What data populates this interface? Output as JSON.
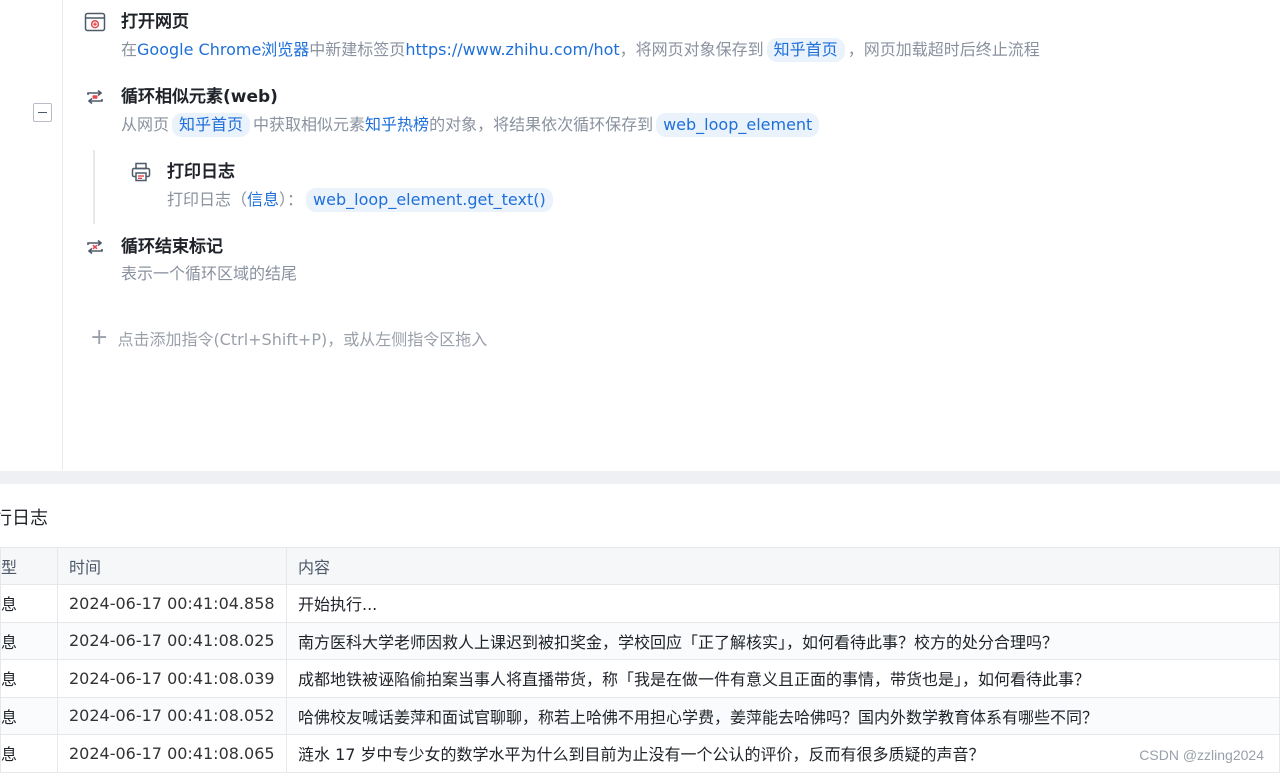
{
  "flow": {
    "steps": [
      {
        "title": "打开网页",
        "desc": {
          "t1": "在",
          "browser": "Google Chrome浏览器",
          "t2": "中新建标签页",
          "url": "https://www.zhihu.com/hot",
          "t3": "，将网页对象保存到",
          "var": "知乎首页",
          "t4": "，网页加载超时后终止流程"
        }
      },
      {
        "title": "循环相似元素(web)",
        "desc": {
          "t1": "从网页",
          "page": "知乎首页",
          "t2": "中获取相似元素",
          "elem": "知乎热榜",
          "t3": "的对象，将结果依次循环保存到",
          "var": "web_loop_element"
        }
      },
      {
        "title": "打印日志",
        "desc": {
          "t1": "打印日志（",
          "level": "信息",
          "t2": "）：",
          "expr": "web_loop_element.get_text()"
        }
      },
      {
        "title": "循环结束标记",
        "desc": {
          "t1": "表示一个循环区域的结尾"
        }
      }
    ],
    "add_hint": "点击添加指令(Ctrl+Shift+P)，或从左侧指令区拖入"
  },
  "log": {
    "title": "行日志",
    "columns": [
      "型",
      "时间",
      "内容"
    ],
    "rows": [
      {
        "type": "息",
        "time": "2024-06-17 00:41:04.858",
        "content": "开始执行..."
      },
      {
        "type": "息",
        "time": "2024-06-17 00:41:08.025",
        "content": "南方医科大学老师因救人上课迟到被扣奖金，学校回应「正了解核实」，如何看待此事？校方的处分合理吗？"
      },
      {
        "type": "息",
        "time": "2024-06-17 00:41:08.039",
        "content": "成都地铁被诬陷偷拍案当事人将直播带货，称「我是在做一件有意义且正面的事情，带货也是」，如何看待此事？"
      },
      {
        "type": "息",
        "time": "2024-06-17 00:41:08.052",
        "content": "哈佛校友喊话姜萍和面试官聊聊，称若上哈佛不用担心学费，姜萍能去哈佛吗？国内外数学教育体系有哪些不同？"
      },
      {
        "type": "息",
        "time": "2024-06-17 00:41:08.065",
        "content": "涟水 17 岁中专少女的数学水平为什么到目前为止没有一个公认的评价，反而有很多质疑的声音？"
      }
    ]
  },
  "watermark": "CSDN @zzling2024",
  "colors": {
    "link": "#1e6fd9",
    "chip_bg": "#eaf2fc",
    "muted": "#8a919f",
    "icon_red": "#e5484d"
  },
  "icons": [
    "browser-open-icon",
    "loop-icon",
    "printer-icon",
    "loop-end-icon",
    "collapse-icon",
    "plus-icon"
  ]
}
